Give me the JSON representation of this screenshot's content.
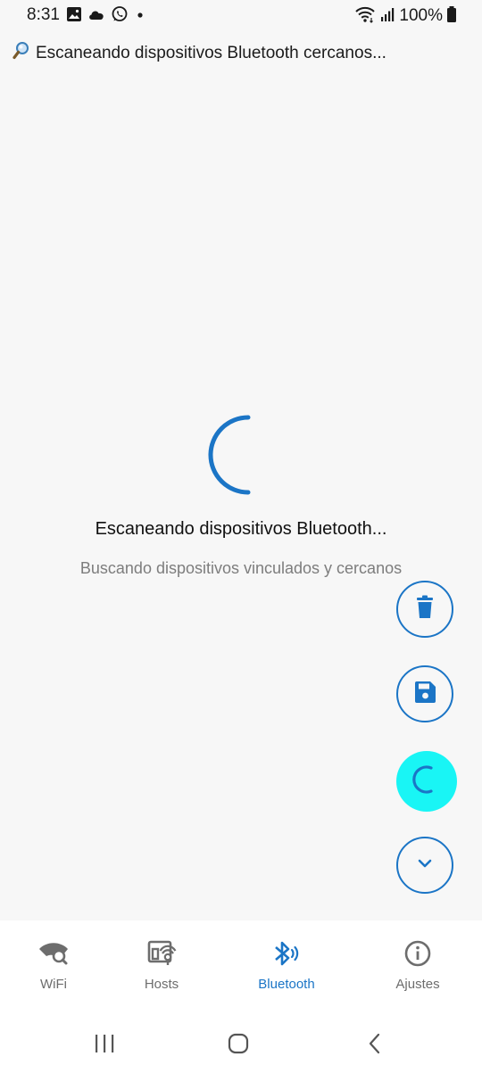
{
  "status_bar": {
    "time": "8:31",
    "battery": "100%",
    "left_icons": [
      "gallery-icon",
      "cloud-icon",
      "whatsapp-icon",
      "dot-icon"
    ],
    "right_icons": [
      "wifi-icon",
      "signal-icon",
      "battery-icon"
    ]
  },
  "header": {
    "icon": "magnifier-icon",
    "text": "Escaneando dispositivos Bluetooth cercanos..."
  },
  "main": {
    "title": "Escaneando dispositivos Bluetooth...",
    "subtitle": "Buscando dispositivos vinculados y cercanos"
  },
  "fabs": [
    {
      "icon": "trash-icon"
    },
    {
      "icon": "save-icon"
    },
    {
      "icon": "scan-spinner-icon",
      "state": "scanning"
    },
    {
      "icon": "chevron-down-icon"
    }
  ],
  "bottom_nav": {
    "items": [
      {
        "label": "WiFi",
        "icon": "wifi-search-icon",
        "active": false
      },
      {
        "label": "Hosts",
        "icon": "hosts-icon",
        "active": false
      },
      {
        "label": "Bluetooth",
        "icon": "bluetooth-icon",
        "active": true
      },
      {
        "label": "Ajustes",
        "icon": "info-icon",
        "active": false
      }
    ]
  },
  "colors": {
    "accent": "#1b75c6",
    "scan_fab": "#19f5f5",
    "background": "#f7f7f7",
    "muted_text": "#7d7d7d"
  }
}
